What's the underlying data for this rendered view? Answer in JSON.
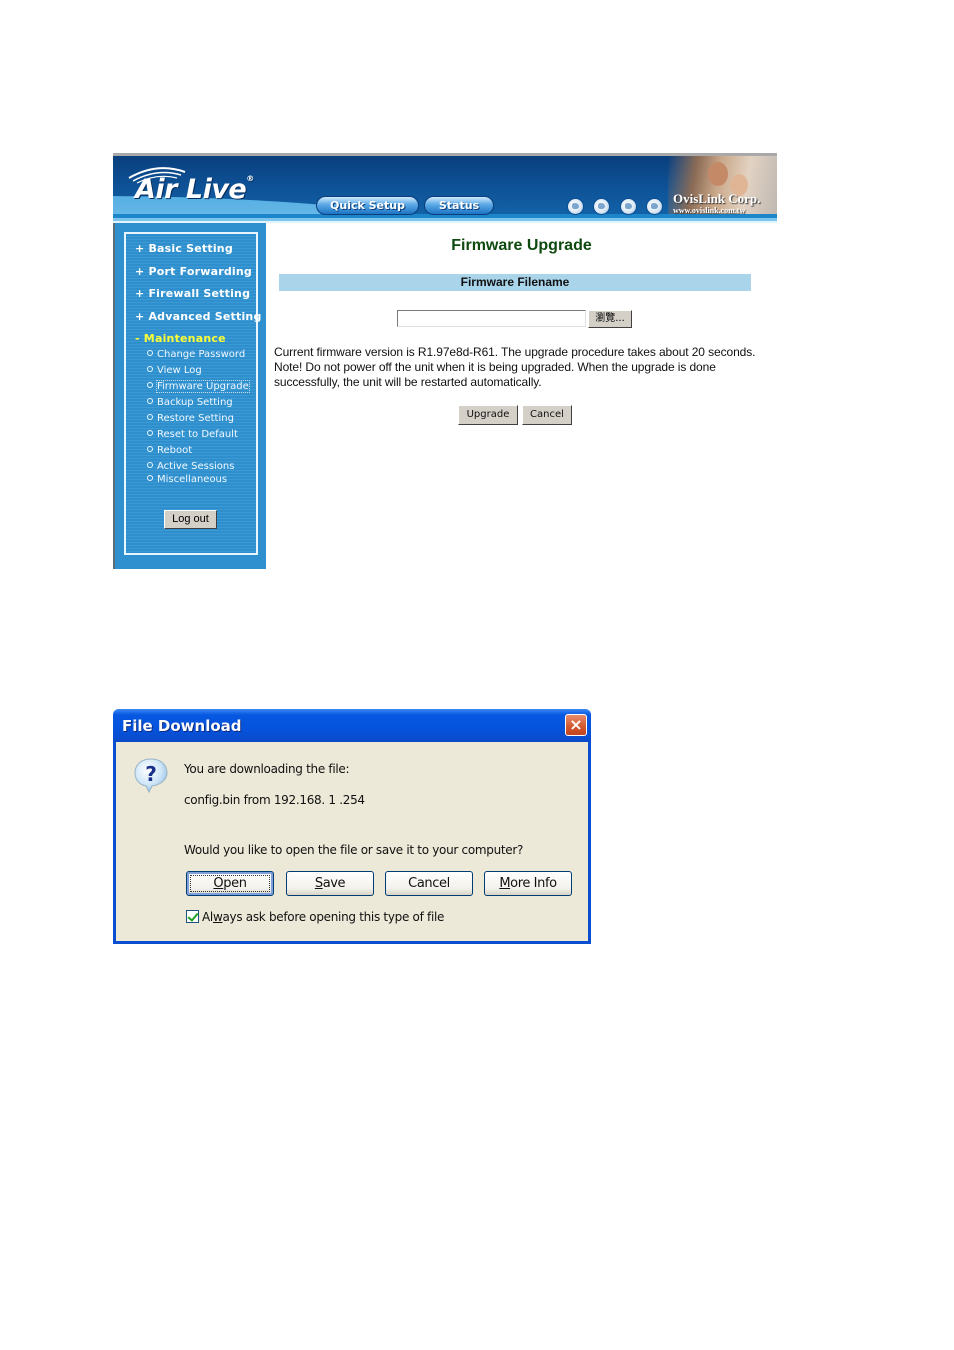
{
  "router": {
    "brand": "Air Live",
    "registered_mark": "®",
    "nav": {
      "quick_setup": "Quick Setup",
      "status": "Status"
    },
    "globe_icons": [
      "globe-icon",
      "globe-icon",
      "globe-icon",
      "globe-icon"
    ],
    "corp_name": "OvisLink Corp.",
    "corp_url": "www.ovislink.com.tw",
    "sidebar": {
      "menu": [
        {
          "label": "+ Basic Setting",
          "active": false
        },
        {
          "label": "+ Port Forwarding",
          "active": false
        },
        {
          "label": "+ Firewall Setting",
          "active": false
        },
        {
          "label": "+ Advanced Setting",
          "active": false
        },
        {
          "label": "- Maintenance",
          "active": true
        }
      ],
      "submenu": [
        {
          "label": "Change Password"
        },
        {
          "label": "View Log"
        },
        {
          "label": "Firmware Upgrade",
          "current": true
        },
        {
          "label": "Backup Setting"
        },
        {
          "label": "Restore Setting"
        },
        {
          "label": "Reset to Default"
        },
        {
          "label": "Reboot"
        },
        {
          "label": "Active Sessions"
        },
        {
          "label": "Miscellaneous"
        }
      ],
      "logout_label": "Log out"
    },
    "content": {
      "title": "Firmware Upgrade",
      "section_header": "Firmware Filename",
      "file_input_value": "",
      "browse_label": "瀏覽...",
      "description": "Current firmware version is R1.97e8d-R61. The upgrade procedure takes about 20 seconds. Note! Do not power off the unit when it is being upgraded. When the upgrade is done successfully, the unit will be restarted automatically.",
      "upgrade_label": "Upgrade",
      "cancel_label": "Cancel"
    }
  },
  "dialog": {
    "title": "File Download",
    "close_icon": "×",
    "line1": "You are downloading the file:",
    "line2": "config.bin from 192.168.  1  .254",
    "line3": "Would you like to open the file or save it to your computer?",
    "buttons": {
      "open": {
        "mnemonic": "O",
        "rest": "pen"
      },
      "save": {
        "mnemonic": "S",
        "rest": "ave"
      },
      "cancel": "Cancel",
      "more_info": {
        "mnemonic": "M",
        "rest": "ore Info"
      }
    },
    "checkbox": {
      "checked": true,
      "label_pre": "Al",
      "label_mnemonic": "w",
      "label_post": "ays ask before opening this type of file"
    }
  }
}
